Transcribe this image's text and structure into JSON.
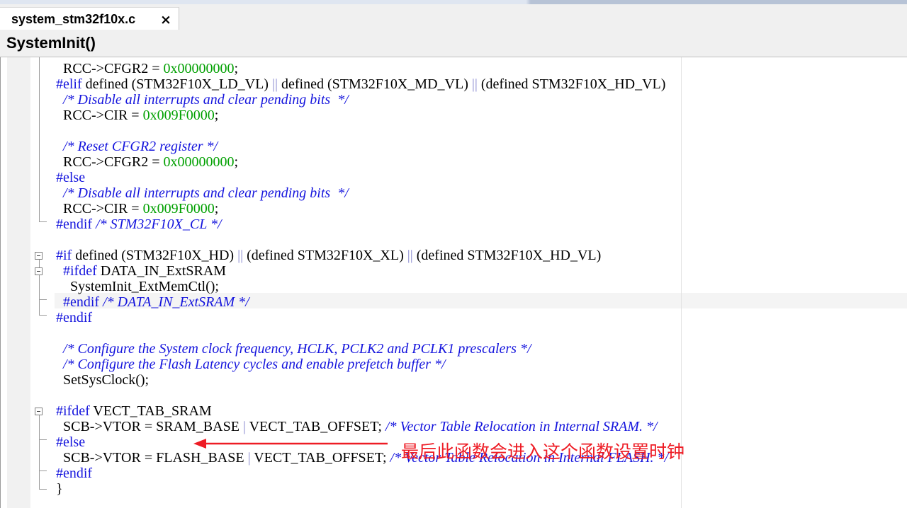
{
  "tab": {
    "title": "system_stm32f10x.c",
    "close_glyph": "×"
  },
  "function_bar": {
    "name": "SystemInit()"
  },
  "annotation": {
    "text": "最后此函数会进入这个函数设置时钟",
    "color": "#ee1c25"
  },
  "colors": {
    "keyword": "#1515dd",
    "number": "#00a000",
    "comment": "#1515dd"
  },
  "icons": [
    "close-icon",
    "fold-collapse-icon",
    "red-arrow-icon"
  ],
  "code_lines": [
    [
      {
        "t": "  RCC->CFGR2 = ",
        "c": ""
      },
      {
        "t": "0x00000000",
        "c": "num"
      },
      {
        "t": ";",
        "c": ""
      }
    ],
    [
      {
        "t": "#elif",
        "c": "kw"
      },
      {
        "t": " defined (STM32F10X_LD_VL) ",
        "c": ""
      },
      {
        "t": "||",
        "c": "op"
      },
      {
        "t": " defined (STM32F10X_MD_VL) ",
        "c": ""
      },
      {
        "t": "||",
        "c": "op"
      },
      {
        "t": " (defined STM32F10X_HD_VL)",
        "c": ""
      }
    ],
    [
      {
        "t": "  /* Disable all interrupts and clear pending bits  */",
        "c": "cm"
      }
    ],
    [
      {
        "t": "  RCC->CIR = ",
        "c": ""
      },
      {
        "t": "0x009F0000",
        "c": "num"
      },
      {
        "t": ";",
        "c": ""
      }
    ],
    [
      {
        "t": "",
        "c": ""
      }
    ],
    [
      {
        "t": "  /* Reset CFGR2 register */",
        "c": "cm"
      }
    ],
    [
      {
        "t": "  RCC->CFGR2 = ",
        "c": ""
      },
      {
        "t": "0x00000000",
        "c": "num"
      },
      {
        "t": ";",
        "c": ""
      }
    ],
    [
      {
        "t": "#else",
        "c": "kw"
      }
    ],
    [
      {
        "t": "  /* Disable all interrupts and clear pending bits  */",
        "c": "cm"
      }
    ],
    [
      {
        "t": "  RCC->CIR = ",
        "c": ""
      },
      {
        "t": "0x009F0000",
        "c": "num"
      },
      {
        "t": ";",
        "c": ""
      }
    ],
    [
      {
        "t": "#endif",
        "c": "kw"
      },
      {
        "t": " /* STM32F10X_CL */",
        "c": "cm"
      }
    ],
    [
      {
        "t": "",
        "c": ""
      }
    ],
    [
      {
        "t": "#if",
        "c": "kw"
      },
      {
        "t": " defined (STM32F10X_HD) ",
        "c": ""
      },
      {
        "t": "||",
        "c": "op"
      },
      {
        "t": " (defined STM32F10X_XL) ",
        "c": ""
      },
      {
        "t": "||",
        "c": "op"
      },
      {
        "t": " (defined STM32F10X_HD_VL)",
        "c": ""
      }
    ],
    [
      {
        "t": "  #ifdef",
        "c": "kw"
      },
      {
        "t": " DATA_IN_ExtSRAM",
        "c": ""
      }
    ],
    [
      {
        "t": "    SystemInit_ExtMemCtl();",
        "c": ""
      }
    ],
    [
      {
        "t": "  #endif",
        "c": "kw"
      },
      {
        "t": " /* DATA_IN_ExtSRAM */",
        "c": "cm"
      }
    ],
    [
      {
        "t": "#endif",
        "c": "kw"
      }
    ],
    [
      {
        "t": "",
        "c": ""
      }
    ],
    [
      {
        "t": "  /* Configure the System clock frequency, HCLK, PCLK2 and PCLK1 prescalers */",
        "c": "cm"
      }
    ],
    [
      {
        "t": "  /* Configure the Flash Latency cycles and enable prefetch buffer */",
        "c": "cm"
      }
    ],
    [
      {
        "t": "  SetSysClock();",
        "c": ""
      }
    ],
    [
      {
        "t": "",
        "c": ""
      }
    ],
    [
      {
        "t": "#ifdef",
        "c": "kw"
      },
      {
        "t": " VECT_TAB_SRAM",
        "c": ""
      }
    ],
    [
      {
        "t": "  SCB->VTOR = SRAM_BASE ",
        "c": ""
      },
      {
        "t": "|",
        "c": "op"
      },
      {
        "t": " VECT_TAB_OFFSET; ",
        "c": ""
      },
      {
        "t": "/* Vector Table Relocation in Internal SRAM. */",
        "c": "cm"
      }
    ],
    [
      {
        "t": "#else",
        "c": "kw"
      }
    ],
    [
      {
        "t": "  SCB->VTOR = FLASH_BASE ",
        "c": ""
      },
      {
        "t": "|",
        "c": "op"
      },
      {
        "t": " VECT_TAB_OFFSET; ",
        "c": ""
      },
      {
        "t": "/* Vector Table Relocation in Internal FLASH. */",
        "c": "cm"
      }
    ],
    [
      {
        "t": "#endif",
        "c": "kw"
      }
    ],
    [
      {
        "t": "}",
        "c": ""
      }
    ]
  ]
}
